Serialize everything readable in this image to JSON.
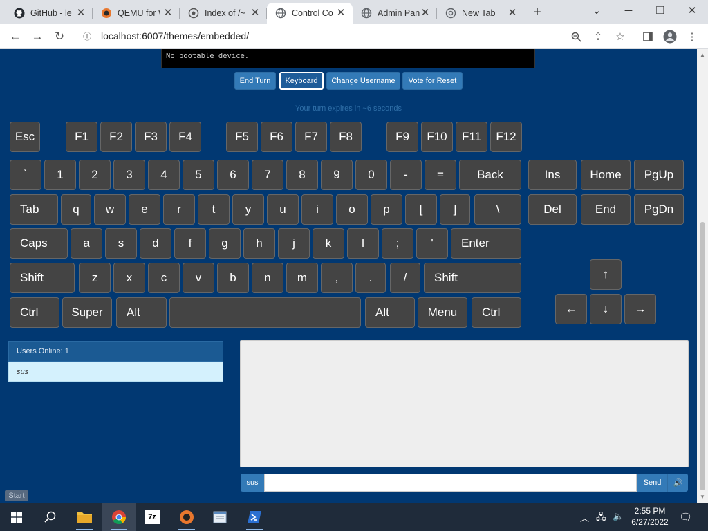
{
  "browser": {
    "tabs": [
      {
        "label": "GitHub - le",
        "icon": "github-icon"
      },
      {
        "label": "QEMU for W",
        "icon": "qemu-icon"
      },
      {
        "label": "Index of /~",
        "icon": "index-icon"
      },
      {
        "label": "Control Co",
        "icon": "globe-icon",
        "active": true
      },
      {
        "label": "Admin Pan",
        "icon": "globe-icon"
      },
      {
        "label": "New Tab",
        "icon": "chrome-icon"
      }
    ],
    "url": "localhost:6007/themes/embedded/"
  },
  "vm": {
    "screen_text": "No bootable device.",
    "buttons": [
      {
        "label": "End Turn",
        "name": "end-turn-button"
      },
      {
        "label": "Keyboard",
        "name": "keyboard-button",
        "selected": true
      },
      {
        "label": "Change Username",
        "name": "change-username-button"
      },
      {
        "label": "Vote for Reset",
        "name": "vote-reset-button"
      }
    ],
    "turn_text": "Your turn expires in ~6 seconds"
  },
  "keyboard": {
    "function_row": [
      "Esc",
      "F1",
      "F2",
      "F3",
      "F4",
      "F5",
      "F6",
      "F7",
      "F8",
      "F9",
      "F10",
      "F11",
      "F12"
    ],
    "row1": [
      "`",
      "1",
      "2",
      "3",
      "4",
      "5",
      "6",
      "7",
      "8",
      "9",
      "0",
      "-",
      "=",
      "Back"
    ],
    "row2": [
      "Tab",
      "q",
      "w",
      "e",
      "r",
      "t",
      "y",
      "u",
      "i",
      "o",
      "p",
      "[",
      "]",
      "\\"
    ],
    "row3": [
      "Caps",
      "a",
      "s",
      "d",
      "f",
      "g",
      "h",
      "j",
      "k",
      "l",
      ";",
      "'",
      "Enter"
    ],
    "row4": [
      "Shift",
      "z",
      "x",
      "c",
      "v",
      "b",
      "n",
      "m",
      ",",
      ".",
      "/",
      "Shift"
    ],
    "row5": [
      "Ctrl",
      "Super",
      "Alt",
      "",
      "Alt",
      "Menu",
      "Ctrl"
    ],
    "nav": [
      "Ins",
      "Home",
      "PgUp",
      "Del",
      "End",
      "PgDn"
    ],
    "arrows": [
      "↑",
      "←",
      "↓",
      "→"
    ]
  },
  "users": {
    "header": "Users Online: 1",
    "list": [
      "sus"
    ]
  },
  "chat": {
    "username": "sus",
    "input_value": "",
    "send_label": "Send",
    "mute_icon": "speaker-icon"
  },
  "start_label": "Start",
  "taskbar": {
    "time": "2:55 PM",
    "date": "6/27/2022",
    "apps": [
      "file-explorer",
      "chrome",
      "7zip",
      "qemu",
      "notepad",
      "powershell"
    ]
  },
  "colors": {
    "page_bg": "#013872",
    "key_bg": "#444444",
    "button_blue": "#337ab7"
  }
}
